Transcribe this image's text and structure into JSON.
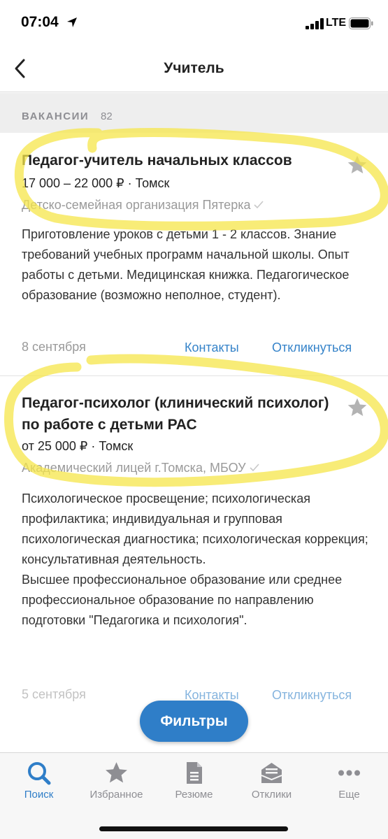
{
  "status_bar": {
    "time": "07:04",
    "network": "LTE"
  },
  "header": {
    "title": "Учитель"
  },
  "section": {
    "label": "ВАКАНСИИ",
    "count": "82"
  },
  "vacancies": [
    {
      "title": "Педагог-учитель начальных классов",
      "salary_location": "17 000 – 22 000 ₽ · Томск",
      "company": "Детско-семейная организация Пятерка",
      "description": "Приготовление уроков с детьми 1 - 2 классов. Знание требований учебных программ начальной школы. Опыт работы с детьми. Медицинская книжка. Педагогическое образование (возможно неполное, студент).",
      "date": "8 сентября",
      "contacts_label": "Контакты",
      "respond_label": "Откликнуться"
    },
    {
      "title": "Педагог-психолог (клинический психолог) по работе с детьми РАС",
      "salary_location": "от 25 000 ₽ · Томск",
      "company": "Академический лицей г.Томска, МБОУ",
      "description": "Психологическое просвещение; психологическая профилактика; индивидуальная и групповая психологическая диагностика; психологическая коррекция; консультативная деятельность.\nВысшее профессиональное образование или среднее профессиональное образование по направлению подготовки \"Педагогика и психология\".",
      "date": "5 сентября",
      "contacts_label": "Контакты",
      "respond_label": "Откликнуться"
    }
  ],
  "filters_button": "Фильтры",
  "tabs": [
    {
      "label": "Поиск",
      "icon": "search-icon",
      "active": true
    },
    {
      "label": "Избранное",
      "icon": "star-icon",
      "active": false
    },
    {
      "label": "Резюме",
      "icon": "document-icon",
      "active": false
    },
    {
      "label": "Отклики",
      "icon": "inbox-icon",
      "active": false
    },
    {
      "label": "Еще",
      "icon": "more-icon",
      "active": false
    }
  ],
  "colors": {
    "accent": "#2f7ec8",
    "link": "#3583c9",
    "highlighter": "#f5e64a",
    "muted": "#9a9a9a"
  }
}
